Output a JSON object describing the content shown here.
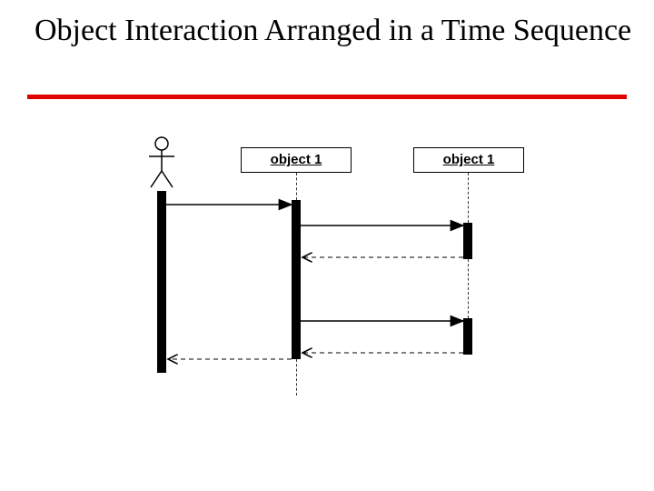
{
  "title": "Object Interaction Arranged in a Time Sequence",
  "objects": {
    "a_label": "object 1",
    "b_label": "object 1"
  },
  "diagram": {
    "type": "uml-sequence",
    "participants": [
      {
        "id": "actor",
        "kind": "actor"
      },
      {
        "id": "obj1",
        "kind": "object",
        "label_ref": "objects.a_label"
      },
      {
        "id": "obj2",
        "kind": "object",
        "label_ref": "objects.b_label"
      }
    ],
    "messages": [
      {
        "from": "actor",
        "to": "obj1",
        "kind": "sync"
      },
      {
        "from": "obj1",
        "to": "obj2",
        "kind": "sync"
      },
      {
        "from": "obj2",
        "to": "obj1",
        "kind": "return"
      },
      {
        "from": "obj1",
        "to": "obj2",
        "kind": "sync"
      },
      {
        "from": "obj2",
        "to": "obj1",
        "kind": "return"
      },
      {
        "from": "obj1",
        "to": "actor",
        "kind": "return"
      }
    ]
  }
}
